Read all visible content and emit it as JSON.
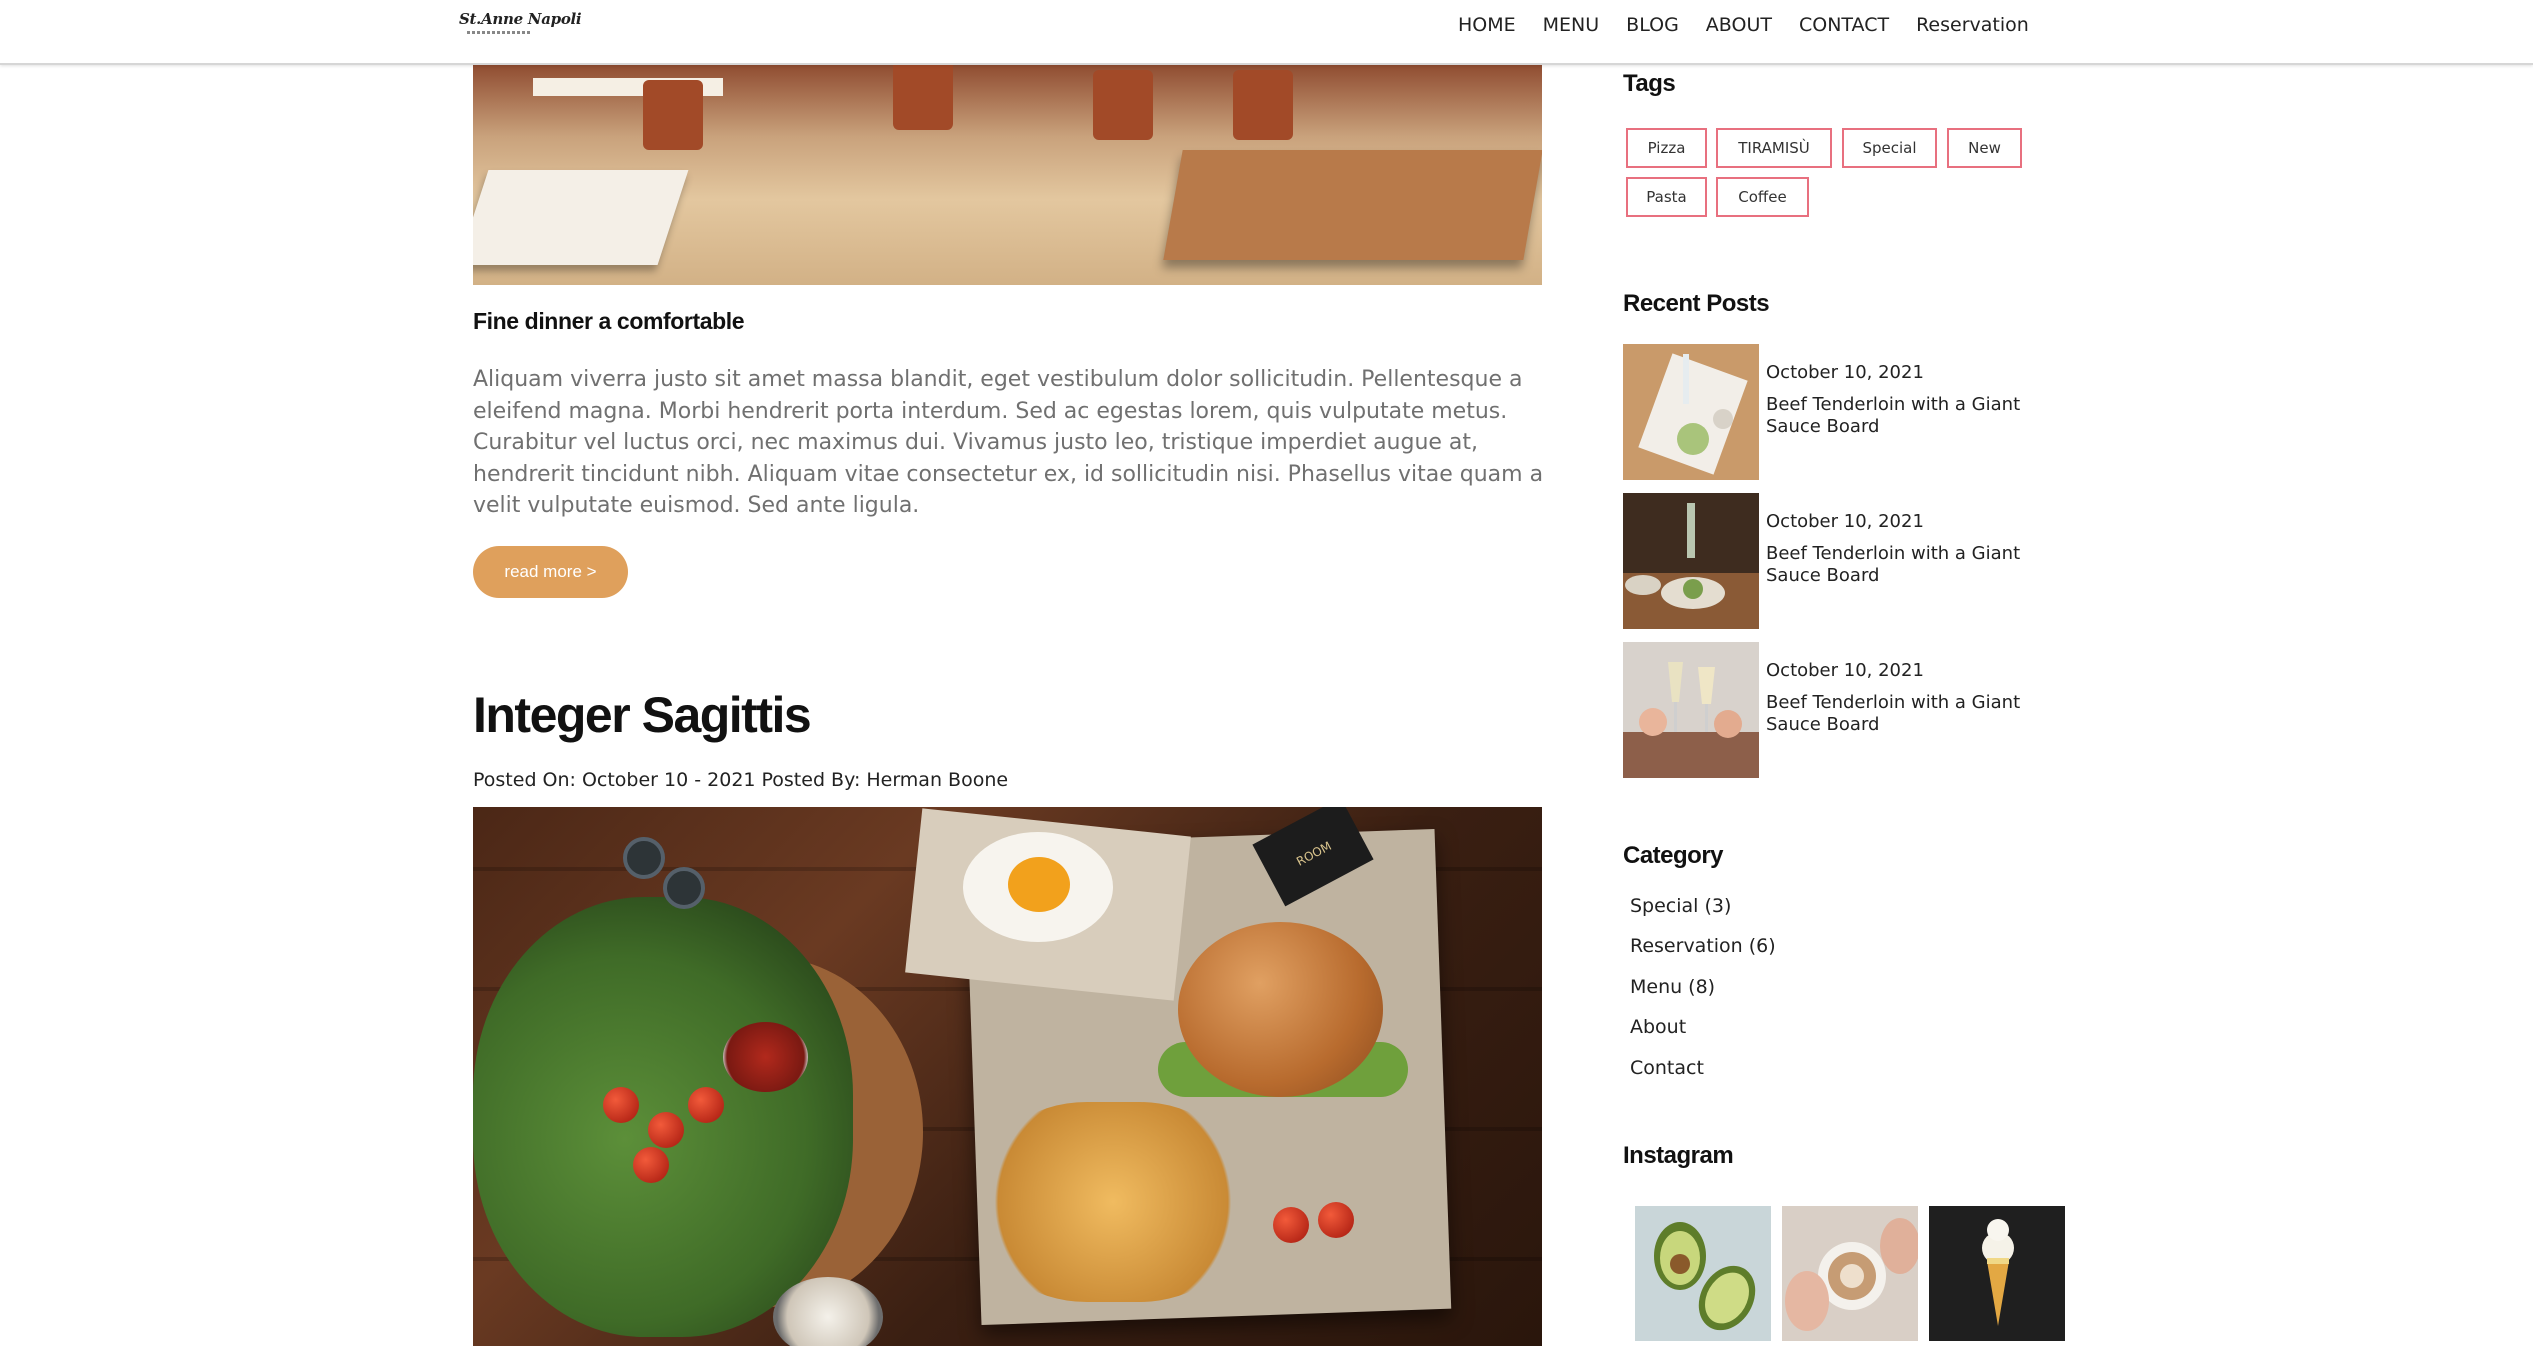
{
  "header": {
    "logo_text": "St.Anne Napoli",
    "nav": [
      "HOME",
      "MENU",
      "BLOG",
      "ABOUT",
      "CONTACT",
      "Reservation"
    ]
  },
  "post1": {
    "title": "Fine dinner a comfortable",
    "excerpt": "Aliquam viverra justo sit amet massa blandit, eget vestibulum dolor sollicitudin. Pellentesque a eleifend magna. Morbi hendrerit porta interdum. Sed ac egestas lorem, quis vulputate metus. Curabitur vel luctus orci, nec maximus dui. Vivamus justo leo, tristique imperdiet augue at, hendrerit tincidunt nibh. Aliquam vitae consectetur ex, id sollicitudin nisi. Phasellus vitae quam a velit vulputate euismod. Sed ante ligula.",
    "read_more": "read more >"
  },
  "post2": {
    "title": "Integer Sagittis",
    "posted_on_label": "Posted On:",
    "posted_on": "October 10 - 2021",
    "posted_by_label": "Posted By:",
    "author": "Herman Boone",
    "image_flag_text": "ROOM"
  },
  "sidebar": {
    "tags_title": "Tags",
    "tags": [
      "Pizza",
      "TIRAMISÙ",
      "Special",
      "New",
      "Pasta",
      "Coffee"
    ],
    "recent_title": "Recent Posts",
    "recent": [
      {
        "date": "October 10, 2021",
        "title": "Beef Tenderloin with a Giant Sauce Board"
      },
      {
        "date": "October 10, 2021",
        "title": "Beef Tenderloin with a Giant Sauce Board"
      },
      {
        "date": "October 10, 2021",
        "title": "Beef Tenderloin with a Giant Sauce Board"
      }
    ],
    "category_title": "Category",
    "categories": [
      {
        "name": "Special",
        "count": "(3)"
      },
      {
        "name": "Reservation",
        "count": "(6)"
      },
      {
        "name": "Menu",
        "count": "(8)"
      },
      {
        "name": "About",
        "count": ""
      },
      {
        "name": "Contact",
        "count": ""
      }
    ],
    "instagram_title": "Instagram"
  },
  "colors": {
    "accent": "#dfa05c",
    "tag_border": "#e8707f"
  }
}
